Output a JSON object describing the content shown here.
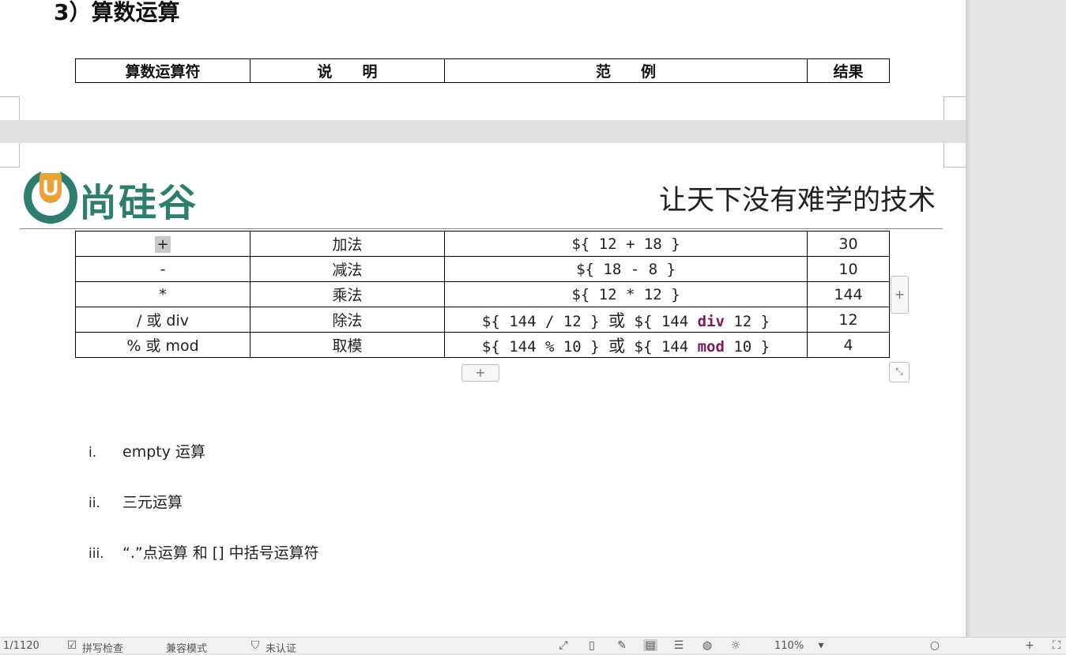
{
  "section_title": "3）算数运算",
  "table_header": [
    "算数运算符",
    "说　　明",
    "范　　例",
    "结果"
  ],
  "logo": {
    "text": "尚硅谷",
    "mark": "U"
  },
  "slogan": "让天下没有难学的技术",
  "operators": [
    {
      "operator": "+",
      "description": "加法",
      "example": "${ 12 + 18 }",
      "result": "30"
    },
    {
      "operator": "-",
      "description": "减法",
      "example": "${ 18 - 8 }",
      "result": "10"
    },
    {
      "operator": "*",
      "description": "乘法",
      "example": "${ 12 * 12 }",
      "result": "144"
    },
    {
      "operator": "/ 或 div",
      "description": "除法",
      "example_a": "${ 144 / 12 }",
      "or": "或",
      "example_b_pre": "${ 144 ",
      "example_b_kw": "div",
      "example_b_post": " 12 }",
      "result": "12"
    },
    {
      "operator": "% 或 mod",
      "description": "取模",
      "example_a": "${ 144 % 10 }",
      "or": "或",
      "example_b_pre": "${ 144 ",
      "example_b_kw": "mod",
      "example_b_post": " 10 }",
      "result": "4"
    }
  ],
  "list": [
    {
      "num": "i.",
      "text": "empty 运算"
    },
    {
      "num": "ii.",
      "text": "三元运算"
    },
    {
      "num": "iii.",
      "text": "“.”点运算  和  []  中括号运算符"
    }
  ],
  "statusbar": {
    "page": "1/1120",
    "spell_check": "拼写检查",
    "compat_mode": "兼容模式",
    "not_certified": "未认证",
    "zoom": "110%"
  },
  "colors": {
    "keyword": "#7a1f5c",
    "logo_green": "#2e7d6e",
    "logo_orange": "#e8a33a"
  }
}
